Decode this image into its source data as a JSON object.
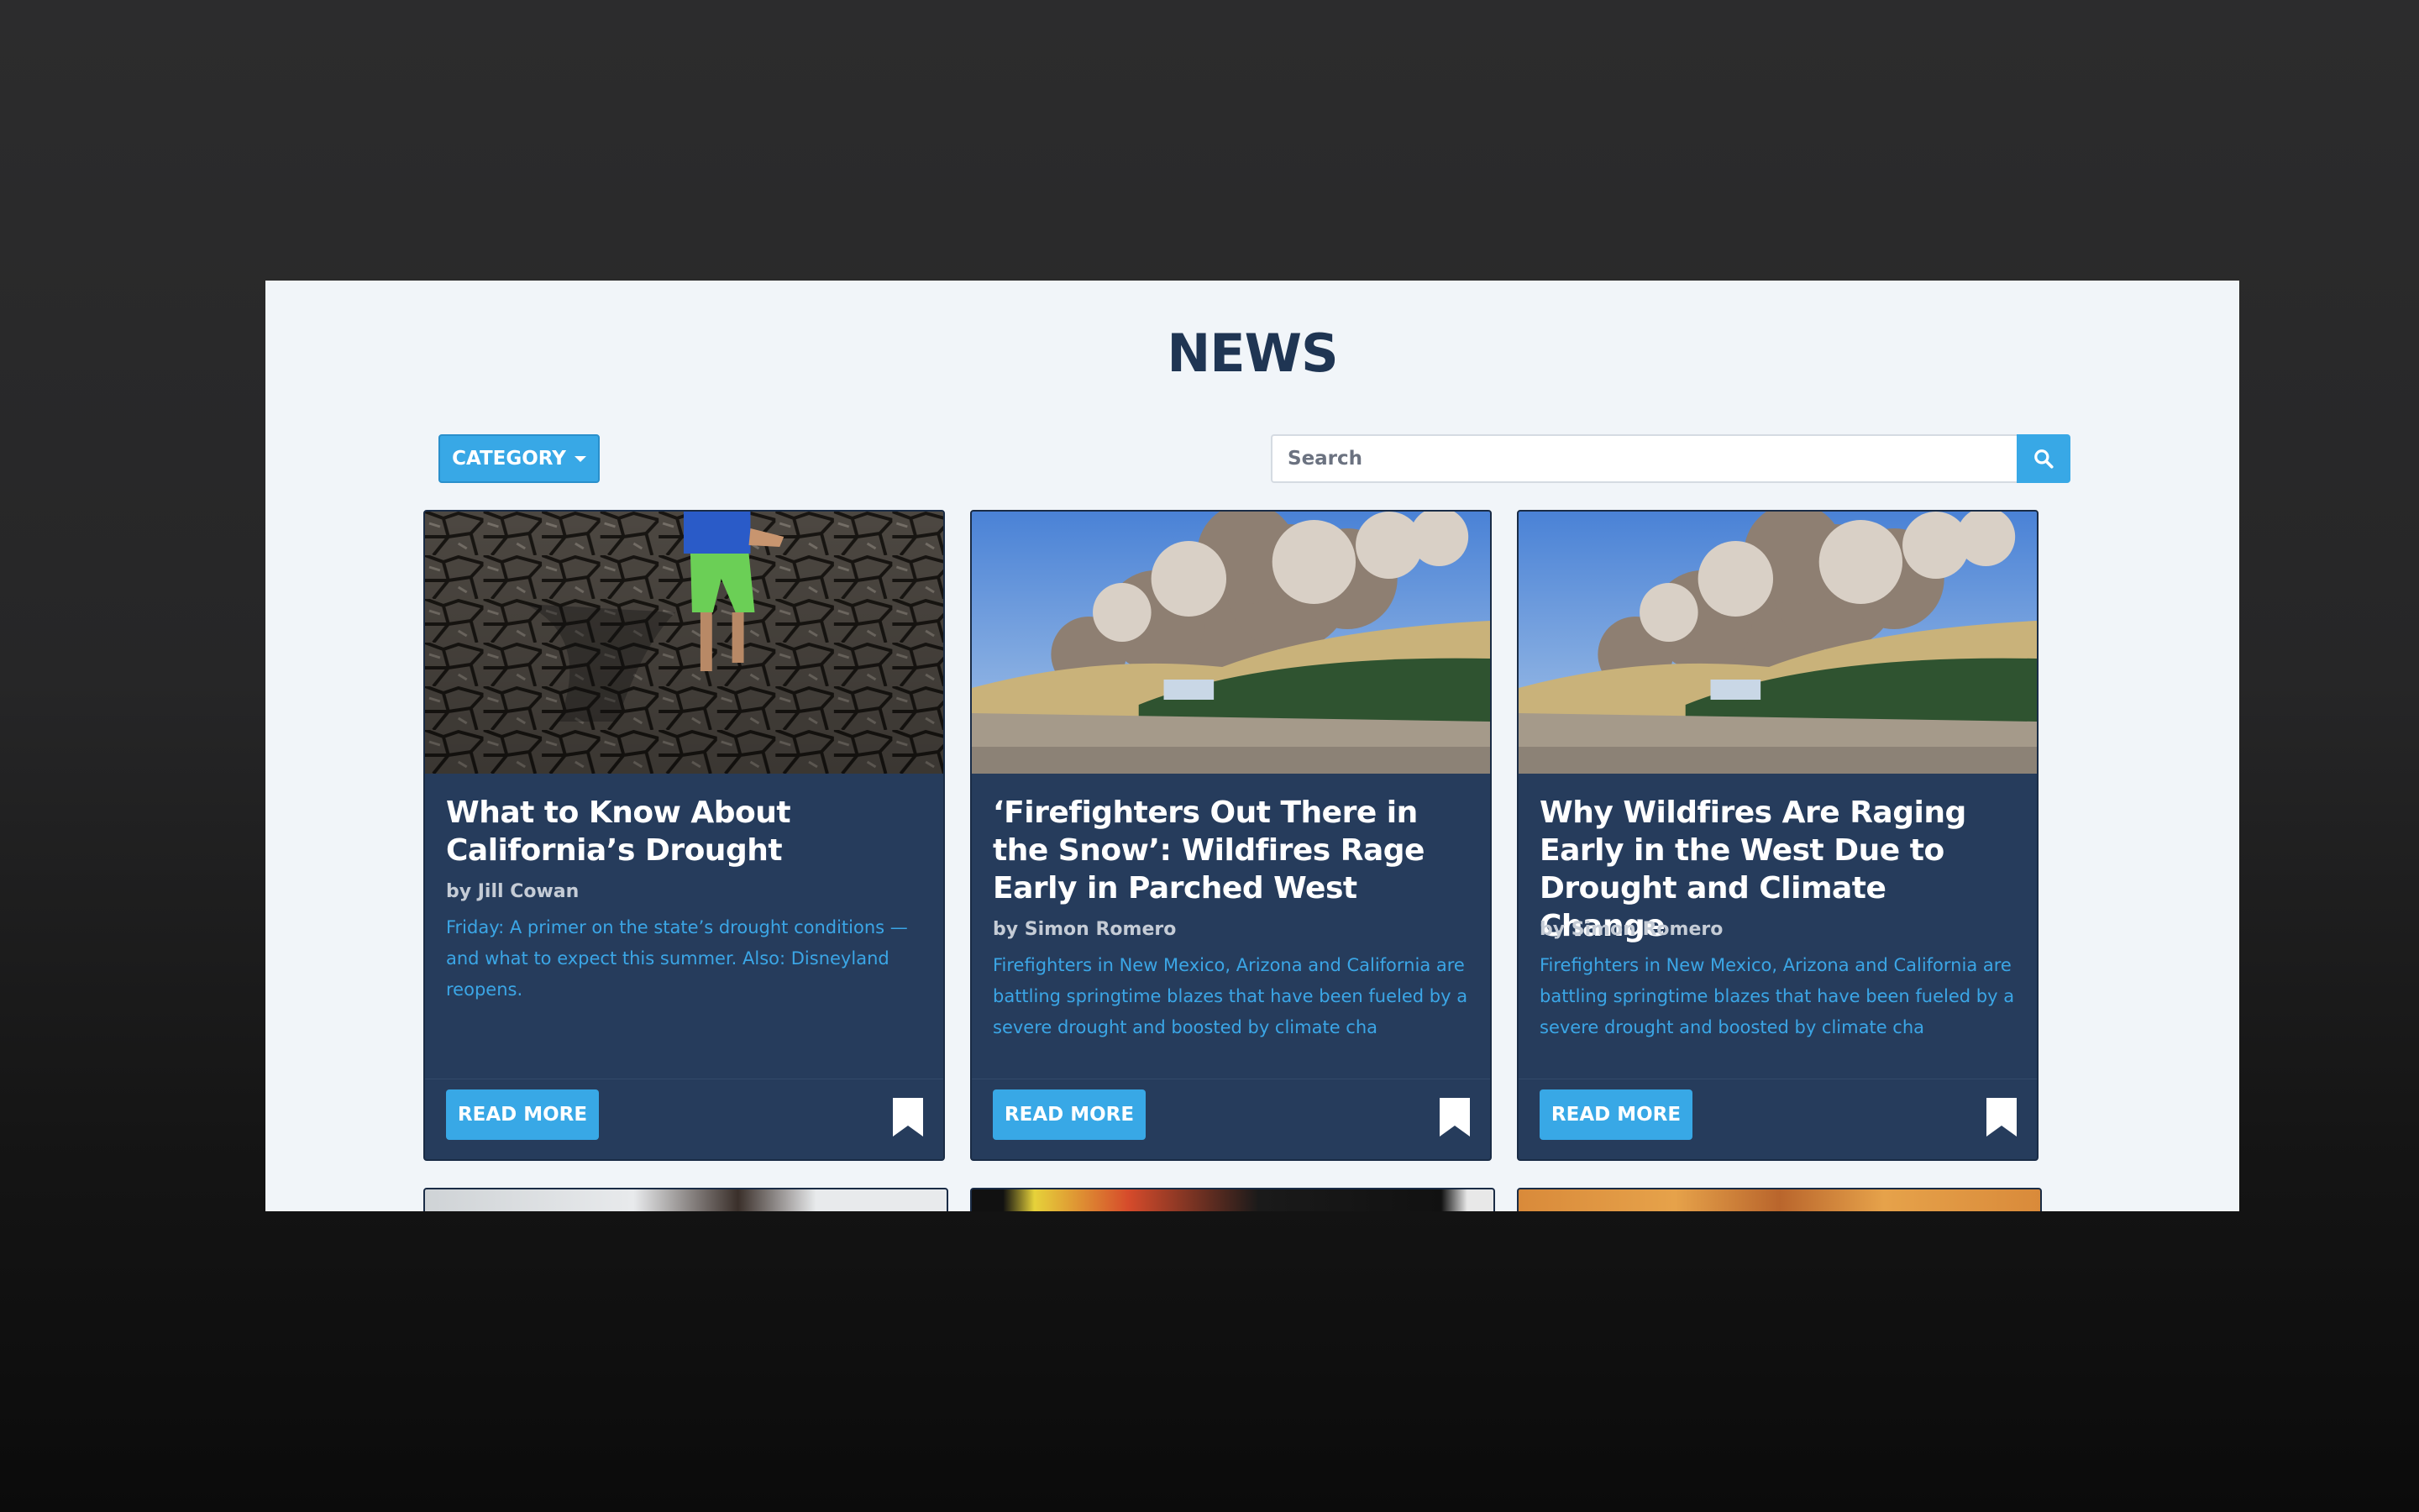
{
  "header": {
    "title": "NEWS"
  },
  "controls": {
    "category_label": "CATEGORY",
    "search_placeholder": "Search"
  },
  "cards": [
    {
      "title": "What to Know About California’s Drought",
      "author": "by Jill Cowan",
      "description": "Friday: A primer on the state’s drought conditions — and what to expect this summer. Also: Disneyland reopens.",
      "read_more": "READ MORE"
    },
    {
      "title": "‘Firefighters Out There in the Snow’: Wildfires Rage Early in Parched West",
      "author": "by Simon Romero",
      "description": "Firefighters in New Mexico, Arizona and California are battling springtime blazes that have been fueled by a severe drought and boosted by climate cha",
      "read_more": "READ MORE"
    },
    {
      "title": "Why Wildfires Are Raging Early in the West Due to Drought and Climate Change",
      "author": "by Simon Romero",
      "description": "Firefighters in New Mexico, Arizona and California are battling springtime blazes that have been fueled by a severe drought and boosted by climate cha",
      "read_more": "READ MORE"
    }
  ],
  "icons": {
    "category": "caret-down-icon",
    "search": "search-icon",
    "bookmark": "bookmark-icon"
  },
  "colors": {
    "accent": "#38a8e6",
    "card_background": "#263c5c",
    "title": "#1f3553",
    "page_background": "#f1f5f9"
  }
}
